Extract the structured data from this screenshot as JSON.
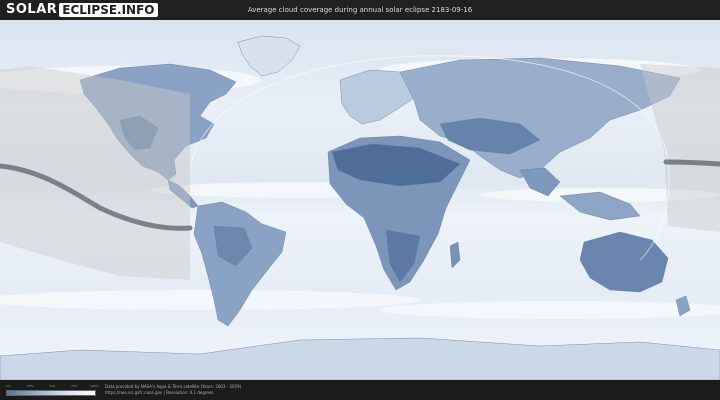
{
  "header": {
    "logo_solar": "SOLAR",
    "logo_eclipse": "ECLIPSE.INFO",
    "title": "Average cloud coverage during annual solar eclipse 2183-09-16"
  },
  "legend": {
    "ticks": [
      "0%",
      "25%",
      "50%",
      "75%",
      "100%"
    ],
    "gradient_colors": [
      "#56759d",
      "#94aecd",
      "#d4e1ef",
      "#ffffff"
    ]
  },
  "credits": {
    "line1": "Data provided by NASA's Aqua & Terra satellite (Years: 2003 - 2019)",
    "line2": "https://neo.sci.gsfc.nasa.gov | Resolution: 0.1 degrees"
  },
  "colors": {
    "background": "#1f1f1f",
    "ocean_cloud": "#e6edf6",
    "land_clear": "#6d87ad",
    "eclipse_path": "#6b7078",
    "night_shade": "#c8c8c8"
  }
}
